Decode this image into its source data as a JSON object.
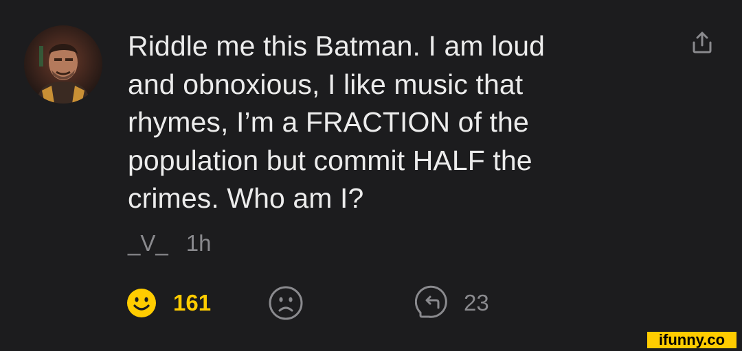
{
  "post": {
    "body": "Riddle me this Batman. I am loud\nand obnoxious, I like music that\nrhymes, I’m a FRACTION of the\npopulation but commit HALF the\ncrimes. Who am I?",
    "author": "_V_",
    "time": "1h"
  },
  "actions": {
    "smile_count": "161",
    "repost_count": "23"
  },
  "icons": {
    "share": "share-icon",
    "smile": "smile-icon",
    "frown": "frown-icon",
    "repost": "repost-icon"
  },
  "watermark": "ifunny.co",
  "colors": {
    "background": "#1c1c1e",
    "text": "#ececec",
    "muted": "#8a8a8e",
    "accent": "#ffcc00"
  }
}
